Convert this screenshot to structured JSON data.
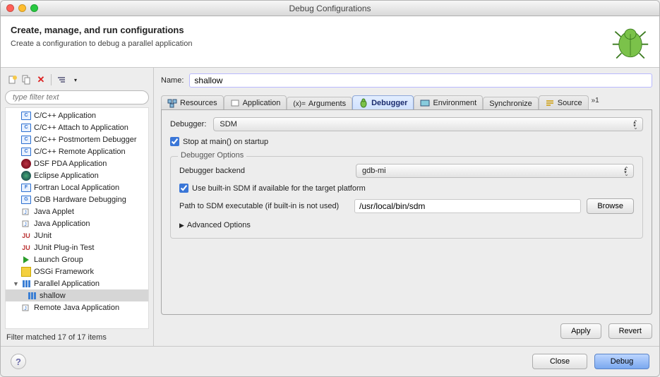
{
  "window": {
    "title": "Debug Configurations"
  },
  "header": {
    "title": "Create, manage, and run configurations",
    "subtitle": "Create a configuration to debug a parallel application"
  },
  "sidebar": {
    "filter_placeholder": "type filter text",
    "items": [
      {
        "label": "C/C++ Application",
        "icon": "c"
      },
      {
        "label": "C/C++ Attach to Application",
        "icon": "c"
      },
      {
        "label": "C/C++ Postmortem Debugger",
        "icon": "c"
      },
      {
        "label": "C/C++ Remote Application",
        "icon": "c"
      },
      {
        "label": "DSF PDA Application",
        "icon": "dsf"
      },
      {
        "label": "Eclipse Application",
        "icon": "ec"
      },
      {
        "label": "Fortran Local Application",
        "icon": "f"
      },
      {
        "label": "GDB Hardware Debugging",
        "icon": "g"
      },
      {
        "label": "Java Applet",
        "icon": "j"
      },
      {
        "label": "Java Application",
        "icon": "j"
      },
      {
        "label": "JUnit",
        "icon": "ju"
      },
      {
        "label": "JUnit Plug-in Test",
        "icon": "ju"
      },
      {
        "label": "Launch Group",
        "icon": "play"
      },
      {
        "label": "OSGi Framework",
        "icon": "osgi"
      },
      {
        "label": "Parallel Application",
        "icon": "par",
        "expanded": true
      },
      {
        "label": "shallow",
        "icon": "par",
        "child": true,
        "selected": true
      },
      {
        "label": "Remote Java Application",
        "icon": "j"
      }
    ],
    "filter_status": "Filter matched 17 of 17 items"
  },
  "form": {
    "name_label": "Name:",
    "name_value": "shallow",
    "tabs": [
      "Resources",
      "Application",
      "Arguments",
      "Debugger",
      "Environment",
      "Synchronize",
      "Source"
    ],
    "tabs_more": "»1",
    "debugger_label": "Debugger:",
    "debugger_value": "SDM",
    "stop_at_main_label": "Stop at main() on startup",
    "group_title": "Debugger Options",
    "backend_label": "Debugger backend",
    "backend_value": "gdb-mi",
    "use_builtin_label": "Use built-in SDM if available for the target platform",
    "sdm_path_label": "Path to SDM executable (if built-in is not used)",
    "sdm_path_value": "/usr/local/bin/sdm",
    "browse_label": "Browse",
    "advanced_label": "Advanced Options",
    "apply_label": "Apply",
    "revert_label": "Revert"
  },
  "footer": {
    "close_label": "Close",
    "debug_label": "Debug"
  }
}
